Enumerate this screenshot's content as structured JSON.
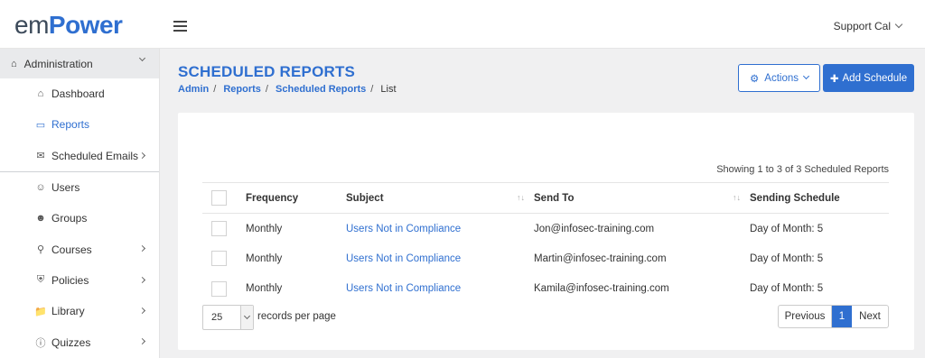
{
  "header": {
    "logo_prefix": "em",
    "logo_main": "Power",
    "user_name": "Support Cal"
  },
  "sidebar": {
    "section": "Administration",
    "items": [
      {
        "label": "Dashboard",
        "icon": "home-icon"
      },
      {
        "label": "Reports",
        "icon": "monitor-icon",
        "active": true
      },
      {
        "label": "Scheduled Emails",
        "icon": "mail-icon"
      },
      {
        "label": "Users",
        "icon": "user-icon"
      },
      {
        "label": "Groups",
        "icon": "users-icon"
      },
      {
        "label": "Courses",
        "icon": "award-icon"
      },
      {
        "label": "Policies",
        "icon": "shield-icon"
      },
      {
        "label": "Library",
        "icon": "folder-icon"
      },
      {
        "label": "Quizzes",
        "icon": "question-icon"
      }
    ]
  },
  "page": {
    "title": "SCHEDULED REPORTS",
    "breadcrumb": [
      "Admin",
      "Reports",
      "Scheduled Reports",
      "List"
    ],
    "actions_label": "Actions",
    "add_label": "Add Schedule",
    "showing": "Showing 1 to 3 of 3 Scheduled Reports"
  },
  "table": {
    "headers": [
      "Frequency",
      "Subject",
      "Send To",
      "Sending Schedule"
    ],
    "rows": [
      [
        "Monthly",
        "Users Not in Compliance",
        "Jon@infosec-training.com",
        "Day of Month: 5"
      ],
      [
        "Monthly",
        "Users Not in Compliance",
        "Martin@infosec-training.com",
        "Day of Month: 5"
      ],
      [
        "Monthly",
        "Users Not in Compliance",
        "Kamila@infosec-training.com",
        "Day of Month: 5"
      ]
    ]
  },
  "pager": {
    "size": "25",
    "size_label": "records per page",
    "prev": "Previous",
    "current": "1",
    "next": "Next"
  },
  "colors": {
    "accent": "#2f6fd0",
    "background": "#f0f0f1"
  }
}
